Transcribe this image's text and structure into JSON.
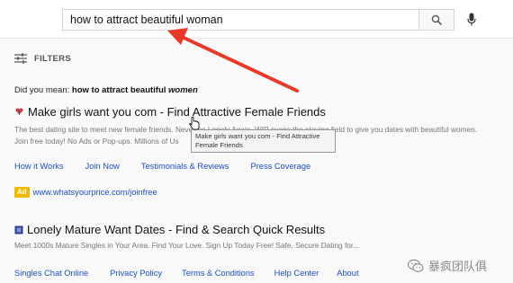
{
  "search": {
    "query": "how to attract beautiful woman",
    "search_icon": "search-icon",
    "mic_icon": "mic-icon"
  },
  "filters": {
    "label": "FILTERS",
    "icon": "sliders-icon"
  },
  "spelling": {
    "prefix": "Did you mean:",
    "suggestion_main": "how to attract beautiful",
    "suggestion_fix": "women"
  },
  "result1": {
    "title": "Make girls want you com - Find Attractive Female Friends",
    "snippet_line1": "The best dating site to meet new female friends. Never be Lonely Again. WIP evens the playing field to give you dates with beautiful women.",
    "snippet_line2": "Join free today! No Ads or Pop-ups. Millions of Us",
    "sitelinks": [
      "How it Works",
      "Join Now",
      "Testimonials & Reviews",
      "Press Coverage"
    ],
    "ad_badge": "Ad",
    "ad_url": "www.whatsyourprice.com/joinfree"
  },
  "tooltip": {
    "text": "Make girls want you com - Find Attractive Female Friends"
  },
  "result2": {
    "title": "Lonely Mature Want Dates - Find & Search Quick Results",
    "snippet": "Meet 1000s Mature Singles in Your Area. Find Your Love. Sign Up Today Free! Safe, Secure Dating for...",
    "sitelinks": [
      "Singles Chat Online",
      "Privacy Policy",
      "Terms & Conditions",
      "Help Center",
      "About"
    ]
  },
  "watermark": {
    "text": "暴疯团队俱"
  },
  "colors": {
    "link": "#1a4fc4",
    "arrow": "#e8392a",
    "ad_badge": "#f2b700"
  }
}
